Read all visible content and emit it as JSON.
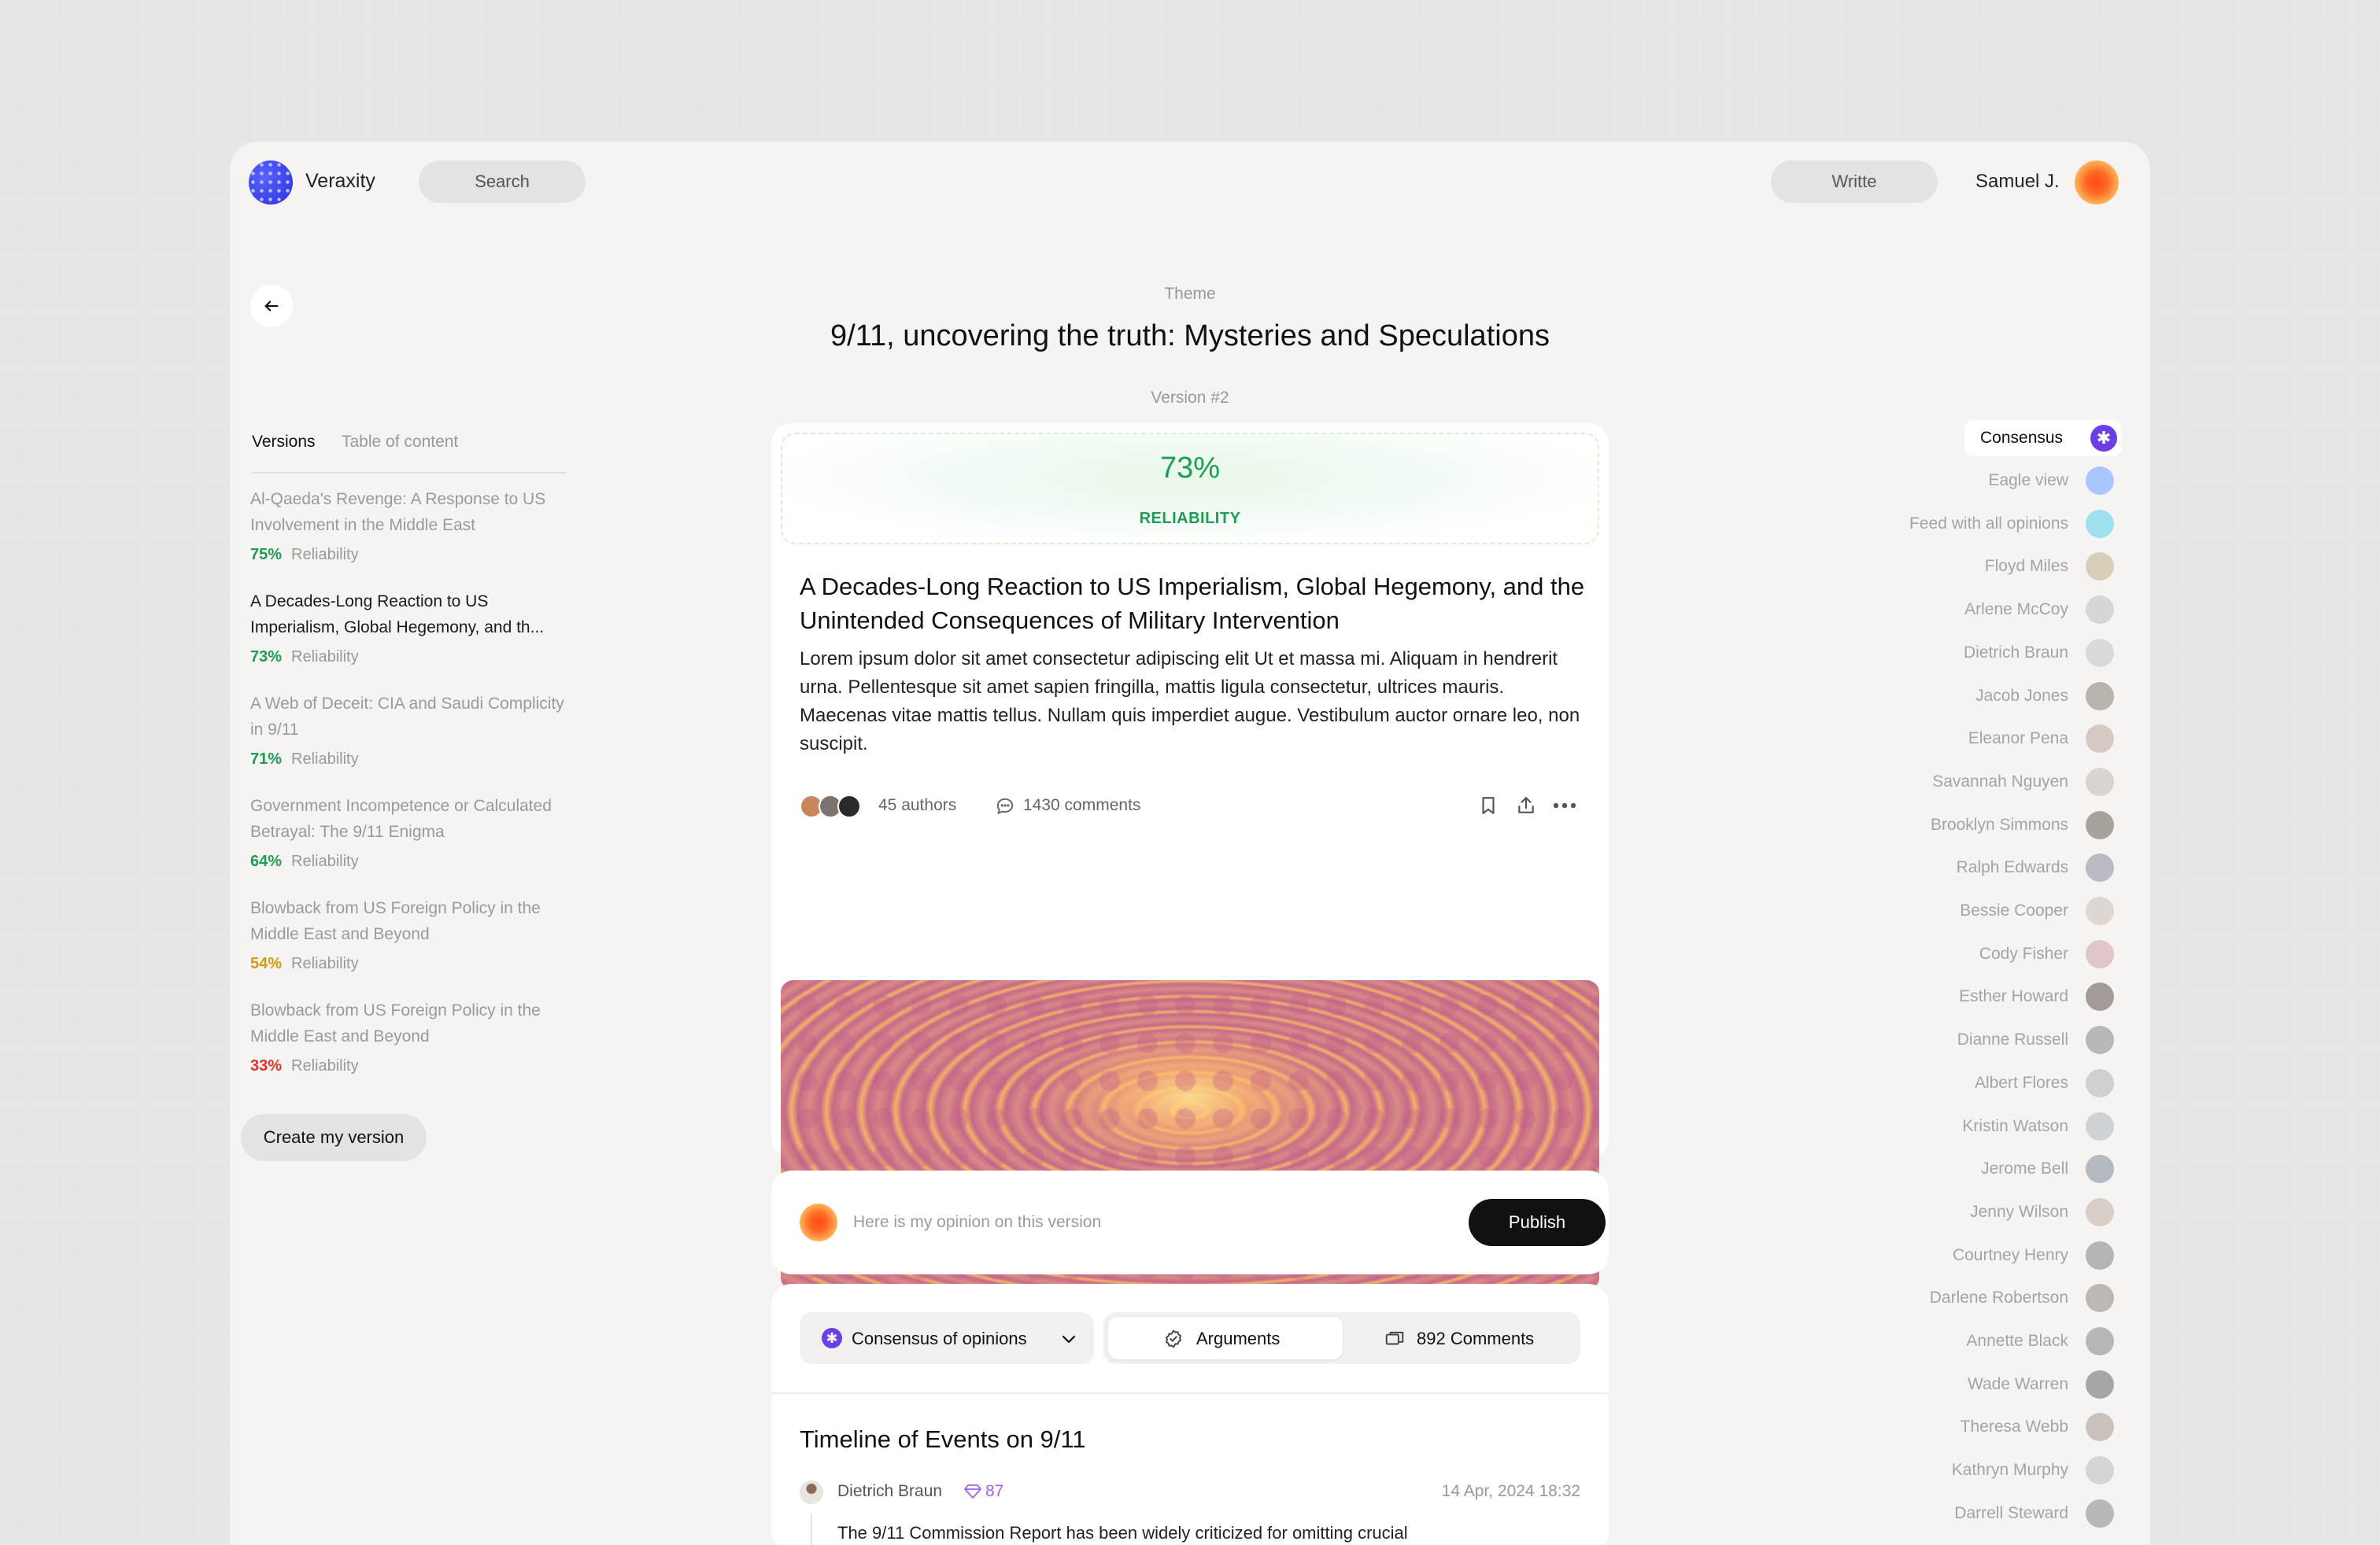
{
  "header": {
    "brand": "Veraxity",
    "search_label": "Search",
    "write_label": "Writte",
    "user_name": "Samuel J."
  },
  "page": {
    "theme_label": "Theme",
    "title": "9/11, uncovering the truth: Mysteries and Speculations",
    "version_label": "Version #2"
  },
  "left": {
    "tabs": [
      "Versions",
      "Table of content"
    ],
    "reliability_word": "Reliability",
    "versions": [
      {
        "title": "Al-Qaeda's Revenge: A Response to US Involvement in the Middle East",
        "pct": "75%",
        "color": "#1f9c54"
      },
      {
        "title": "A Decades-Long Reaction to US Imperialism, Global Hegemony, and th...",
        "pct": "73%",
        "color": "#1f9c54",
        "active": true
      },
      {
        "title": "A Web of Deceit: CIA and Saudi Complicity in 9/11",
        "pct": "71%",
        "color": "#1f9c54"
      },
      {
        "title": "Government Incompetence or Calculated Betrayal: The 9/11 Enigma",
        "pct": "64%",
        "color": "#1f9c54"
      },
      {
        "title": "Blowback from US Foreign Policy in the Middle East and Beyond",
        "pct": "54%",
        "color": "#d49a10"
      },
      {
        "title": "Blowback from US Foreign Policy in the Middle East and Beyond",
        "pct": "33%",
        "color": "#e0322c"
      }
    ],
    "create_label": "Create my version"
  },
  "article": {
    "reliability_pct": "73%",
    "reliability_label": "RELIABILITY",
    "title": "A Decades-Long Reaction to US Imperialism, Global Hegemony, and the Unintended Consequences of Military Intervention",
    "body": "Lorem ipsum dolor sit amet consectetur adipiscing elit Ut et massa mi. Aliquam in hendrerit urna. Pellentesque sit amet sapien fringilla, mattis ligula consectetur, ultrices mauris. Maecenas vitae mattis tellus. Nullam quis imperdiet augue. Vestibulum auctor ornare leo, non suscipit.",
    "authors": "45 authors",
    "comments": "1430 comments"
  },
  "opinion": {
    "placeholder": "Here is my opinion on this version",
    "publish_label": "Publish"
  },
  "discussion": {
    "select_label": "Consensus of opinions",
    "arguments_label": "Arguments",
    "comments_label": "892 Comments",
    "timeline_title": "Timeline of Events on 9/11",
    "post": {
      "author": "Dietrich Braun",
      "score": "87",
      "date": "14 Apr, 2024 18:32",
      "text": "The 9/11 Commission Report has been widely criticized for omitting crucial"
    }
  },
  "right": {
    "consensus_label": "Consensus",
    "items": [
      {
        "label": "Eagle view",
        "color": "#a9c6ff"
      },
      {
        "label": "Feed with all opinions",
        "color": "#9fe0ee"
      },
      {
        "label": "Floyd Miles",
        "color": "#d9ceb8"
      },
      {
        "label": "Arlene McCoy",
        "color": "#d8d5d2"
      },
      {
        "label": "Dietrich Braun",
        "color": "#dcdad8"
      },
      {
        "label": "Jacob Jones",
        "color": "#b9b3ae"
      },
      {
        "label": "Eleanor Pena",
        "color": "#d6c8c2"
      },
      {
        "label": "Savannah Nguyen",
        "color": "#d9d4cf"
      },
      {
        "label": "Brooklyn Simmons",
        "color": "#a8a29c"
      },
      {
        "label": "Ralph Edwards",
        "color": "#b8bcc2"
      },
      {
        "label": "Bessie Cooper",
        "color": "#ded6d0"
      },
      {
        "label": "Cody Fisher",
        "color": "#e0c6c8"
      },
      {
        "label": "Esther Howard",
        "color": "#a39c98"
      },
      {
        "label": "Dianne Russell",
        "color": "#b9b8b6"
      },
      {
        "label": "Albert Flores",
        "color": "#d2cfcc"
      },
      {
        "label": "Kristin Watson",
        "color": "#cfd2d4"
      },
      {
        "label": "Jerome Bell",
        "color": "#b5b9c0"
      },
      {
        "label": "Jenny Wilson",
        "color": "#d8d0c6"
      },
      {
        "label": "Courtney Henry",
        "color": "#b7b3b0"
      },
      {
        "label": "Darlene Robertson",
        "color": "#bdb8b4"
      },
      {
        "label": "Annette Black",
        "color": "#b9b6b3"
      },
      {
        "label": "Wade Warren",
        "color": "#a8a5a2"
      },
      {
        "label": "Theresa Webb",
        "color": "#c9c1ba"
      },
      {
        "label": "Kathryn Murphy",
        "color": "#d3d5d8"
      },
      {
        "label": "Darrell Steward",
        "color": "#bab7b4"
      }
    ]
  }
}
